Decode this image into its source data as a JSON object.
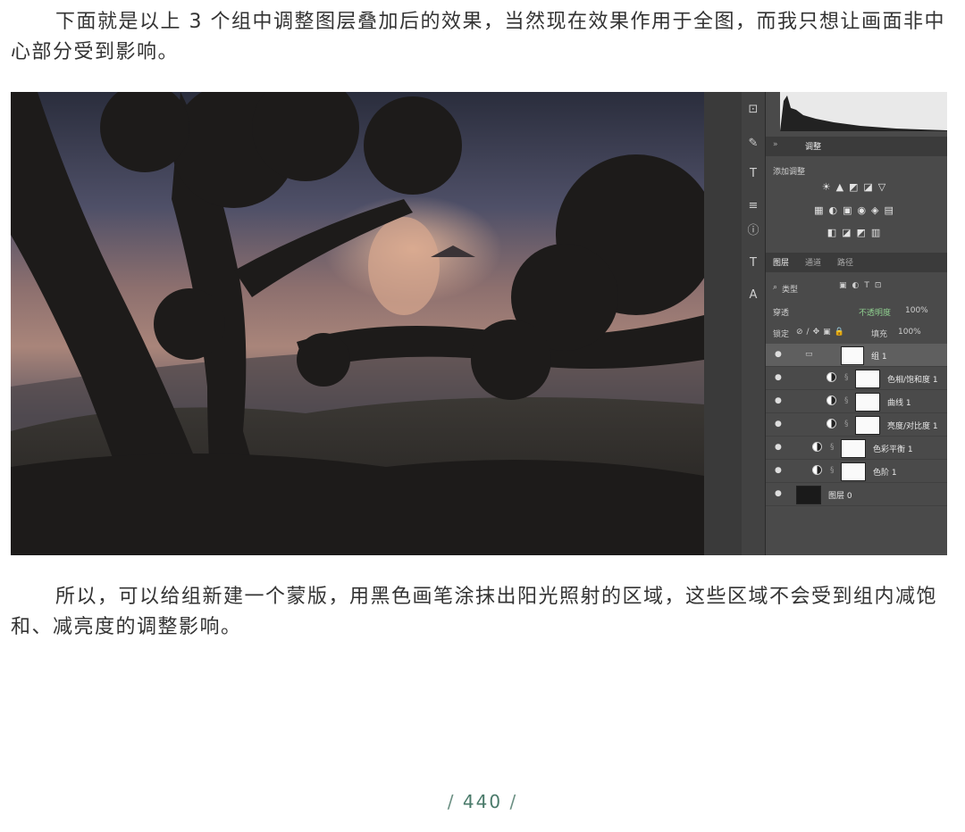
{
  "paragraphs": {
    "p1": "下面就是以上 3 个组中调整图层叠加后的效果，当然现在效果作用于全图，而我只想让画面非中心部分受到影响。",
    "p2": "所以，可以给组新建一个蒙版，用黑色画笔涂抹出阳光照射的区域，这些区域不会受到组内减饱和、减亮度的调整影响。"
  },
  "panel": {
    "top_tab": "调整",
    "add_adjust": "添加调整",
    "layer_tabs": [
      "图层",
      "通道",
      "路径"
    ],
    "filter_kind": "类型",
    "blend_mode": "穿透",
    "opacity_label": "不透明度",
    "opacity_value": "100%",
    "lock_label": "锁定",
    "fill_label": "填充",
    "fill_value": "100%",
    "layers": [
      {
        "name": "组 1",
        "type": "group"
      },
      {
        "name": "色相/饱和度 1",
        "type": "adjust"
      },
      {
        "name": "曲线 1",
        "type": "adjust"
      },
      {
        "name": "亮度/对比度 1",
        "type": "adjust"
      },
      {
        "name": "色彩平衡 1",
        "type": "adjust"
      },
      {
        "name": "色阶 1",
        "type": "adjust"
      },
      {
        "name": "图层 0",
        "type": "image"
      }
    ]
  },
  "page_number": "440",
  "colors": {
    "panel_bg": "#4a4a4a",
    "page_number": "#4a7a6a"
  }
}
